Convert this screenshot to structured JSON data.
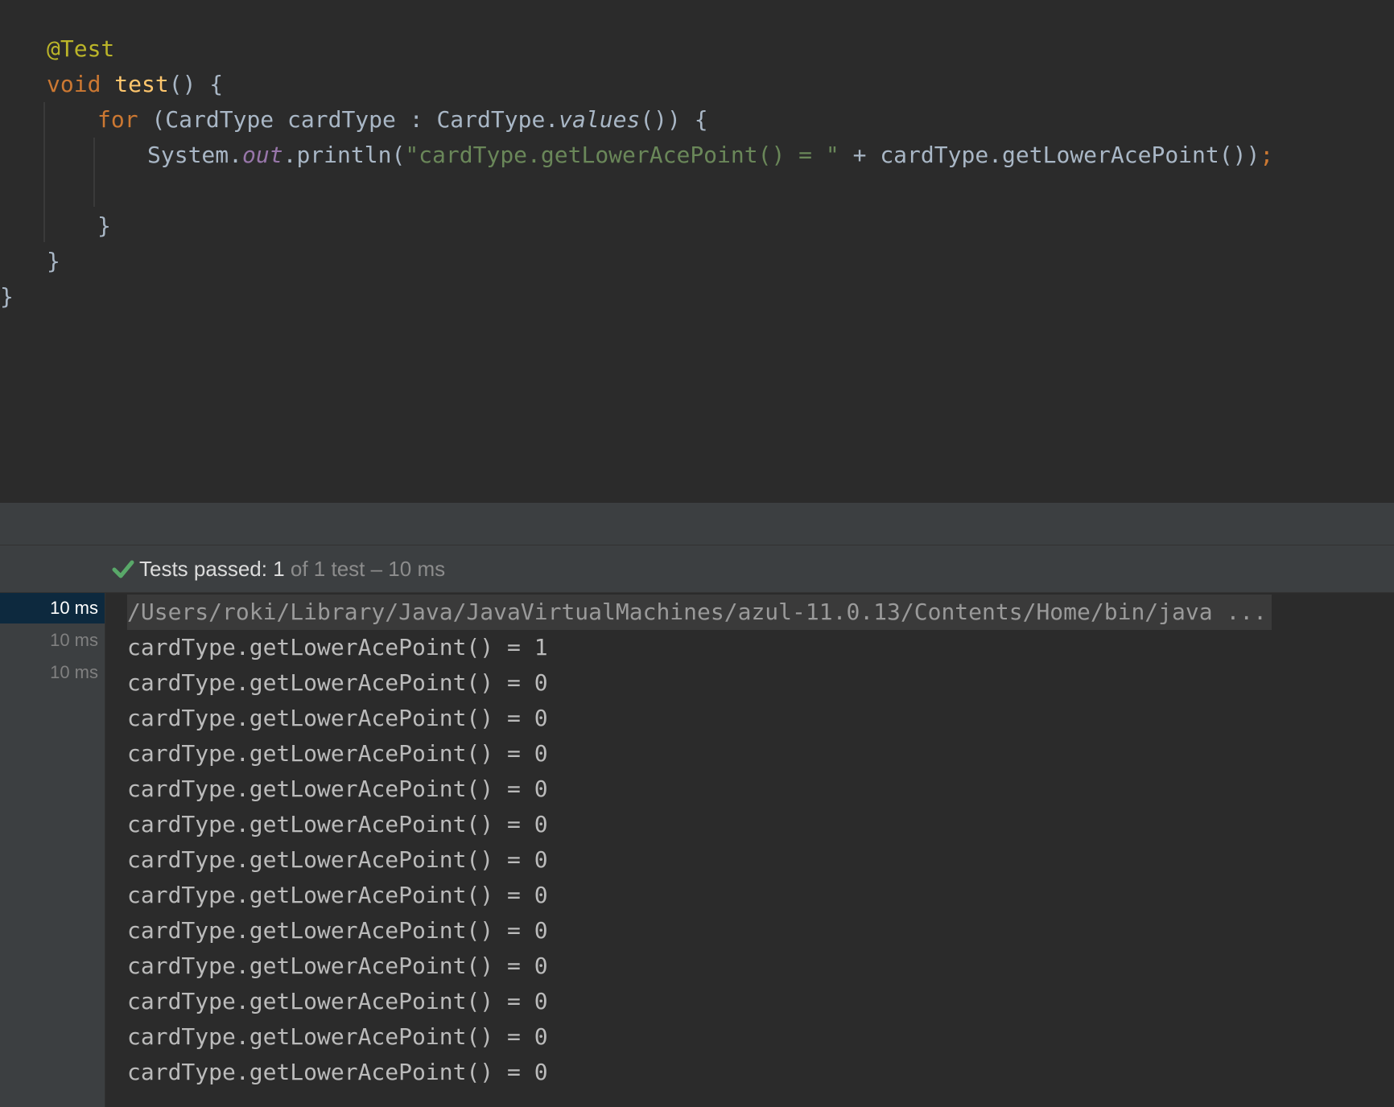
{
  "editor": {
    "annotation": "@Test",
    "method_kw": "void",
    "method_name": "test",
    "method_rest": "() {",
    "for_kw": "for",
    "for_head": " (CardType cardType : CardType.",
    "for_values": "values",
    "for_tail": "()) {",
    "println_class": "System.",
    "println_field": "out",
    "println_call": ".println(",
    "println_string": "\"cardType.getLowerAcePoint() = \"",
    "println_rest": " + cardType.getLowerAcePoint())",
    "semicolon": ";",
    "close_for": "}",
    "close_method": "}",
    "close_class": "}"
  },
  "status": {
    "passed_label": "Tests passed: ",
    "passed_count": "1",
    "summary": " of 1 test – 10 ms"
  },
  "tree": {
    "rows": [
      "10 ms",
      "10 ms",
      "10 ms"
    ]
  },
  "console": {
    "command": "/Users/roki/Library/Java/JavaVirtualMachines/azul-11.0.13/Contents/Home/bin/java ...",
    "lines": [
      "cardType.getLowerAcePoint() = 1",
      "cardType.getLowerAcePoint() = 0",
      "cardType.getLowerAcePoint() = 0",
      "cardType.getLowerAcePoint() = 0",
      "cardType.getLowerAcePoint() = 0",
      "cardType.getLowerAcePoint() = 0",
      "cardType.getLowerAcePoint() = 0",
      "cardType.getLowerAcePoint() = 0",
      "cardType.getLowerAcePoint() = 0",
      "cardType.getLowerAcePoint() = 0",
      "cardType.getLowerAcePoint() = 0",
      "cardType.getLowerAcePoint() = 0",
      "cardType.getLowerAcePoint() = 0"
    ]
  },
  "colors": {
    "check": "#59a869",
    "selection": "#0d293e"
  },
  "icons": {
    "status": "check-icon"
  }
}
